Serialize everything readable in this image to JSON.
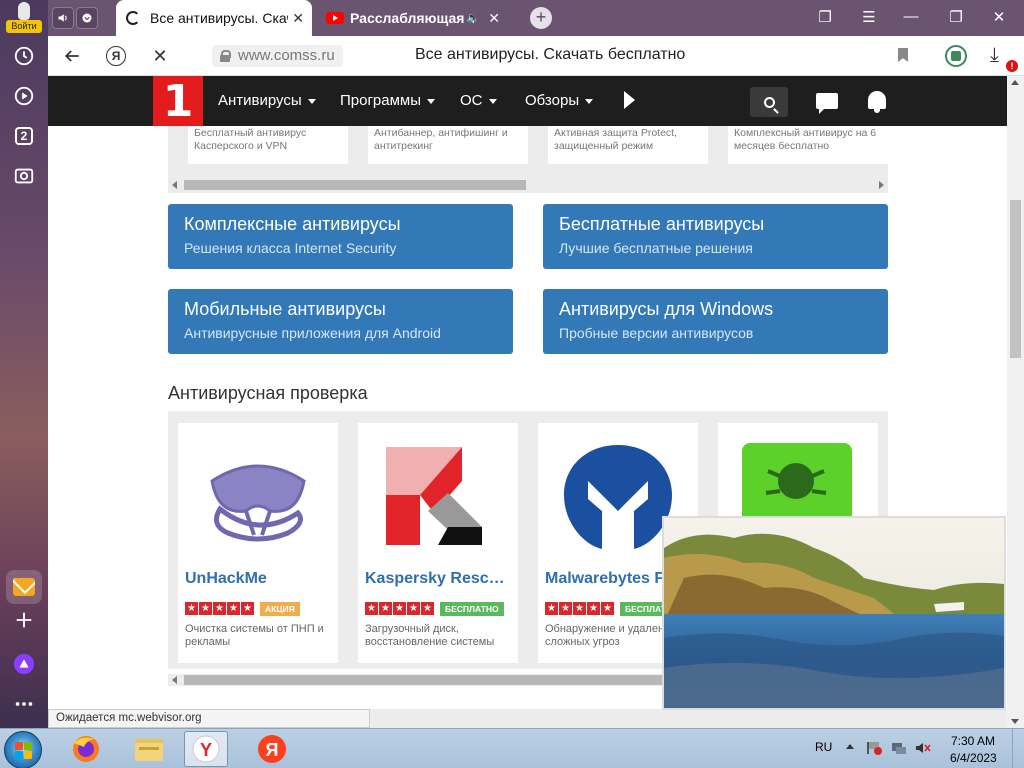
{
  "sidebar": {
    "login_label": "Войти",
    "tab_count": "2"
  },
  "tabs": [
    {
      "title": "Все антивирусы. Скача",
      "active": true
    },
    {
      "title": "Расслабляющая му",
      "active": false
    }
  ],
  "address_bar": {
    "url": "www.comss.ru",
    "page_title": "Все антивирусы. Скачать бесплатно",
    "download_badge": "!"
  },
  "site_nav": {
    "logo": "1",
    "items": [
      "Антивирусы",
      "Программы",
      "ОС",
      "Обзоры"
    ]
  },
  "top_cards": [
    "Бесплатный антивирус Касперского и VPN",
    "Антибаннер, антифишинг и антитрекинг",
    "Активная защита Protect, защищенный режим",
    "Комплексный антивирус на 6 месяцев бесплатно"
  ],
  "categories": [
    {
      "title": "Комплексные антивирусы",
      "subtitle": "Решения класса Internet Security"
    },
    {
      "title": "Бесплатные антивирусы",
      "subtitle": "Лучшие бесплатные решения"
    },
    {
      "title": "Мобильные антивирусы",
      "subtitle": "Антивирусные приложения для Android"
    },
    {
      "title": "Антивирусы для Windows",
      "subtitle": "Пробные версии антивирусов"
    }
  ],
  "section_title": "Антивирусная проверка",
  "products": [
    {
      "name": "UnHackMe",
      "rating": "5",
      "badge": "АКЦИЯ",
      "desc": "Очистка системы от ПНП и рекламы"
    },
    {
      "name": "Kaspersky Resc…",
      "rating": "5",
      "badge": "БЕСПЛАТНО",
      "desc": "Загрузочный диск, восстановление системы"
    },
    {
      "name": "Malwarebytes F",
      "rating": "5",
      "badge": "БЕСПЛАТ",
      "desc": "Обнаружение и удален сложных угроз"
    }
  ],
  "status_text": "Ожидается mc.webvisor.org",
  "taskbar": {
    "lang": "RU",
    "time": "7:30 AM",
    "date": "6/4/2023"
  },
  "colors": {
    "accent_blue": "#3379b7",
    "brand_red": "#e31b1b",
    "tab_strip": "#6a5470",
    "link": "#2f6fad"
  }
}
